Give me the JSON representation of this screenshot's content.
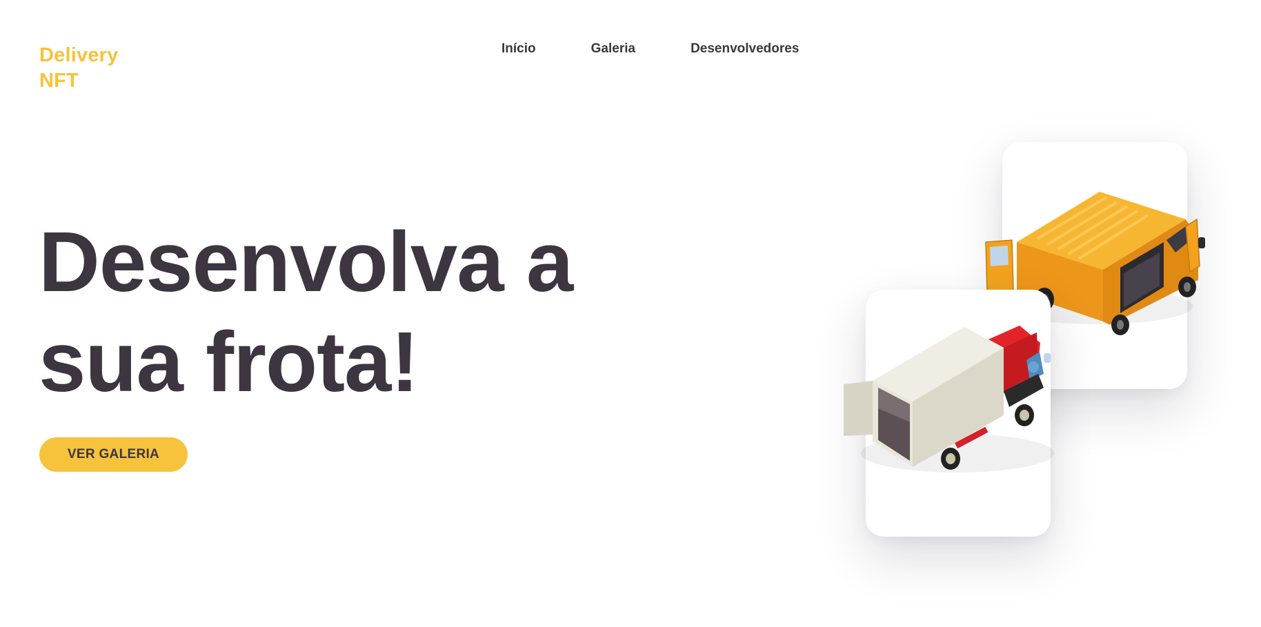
{
  "brand": {
    "line1": "Delivery",
    "line2": "NFT"
  },
  "nav": {
    "items": [
      "Início",
      "Galeria",
      "Desenvolvedores"
    ]
  },
  "hero": {
    "title_line1": "Desenvolva a",
    "title_line2": "sua frota!",
    "cta_label": "VER GALERIA"
  },
  "cards": [
    {
      "name": "van",
      "icon": "van-icon"
    },
    {
      "name": "truck",
      "icon": "truck-icon"
    }
  ],
  "colors": {
    "accent": "#F7C23C",
    "text_dark": "#3D3540",
    "van_orange": "#F2A21E",
    "truck_red": "#E2232A",
    "truck_box": "#E4E1D5"
  }
}
